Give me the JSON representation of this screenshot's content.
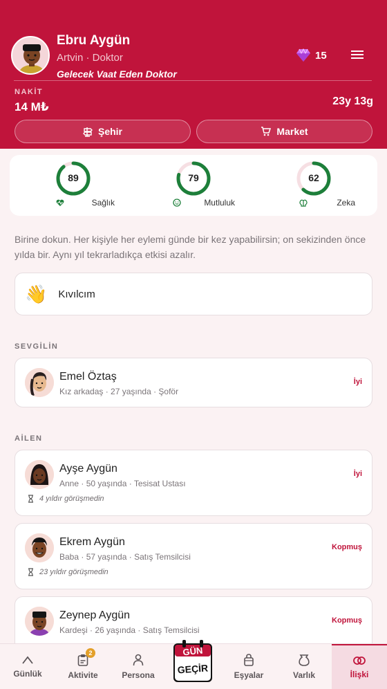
{
  "profile": {
    "name": "Ebru Aygün",
    "location_job": "Artvin · Doktor",
    "title": "Gelecek Vaat Eden Doktor",
    "gems": "15",
    "cash_label": "NAKİT",
    "cash": "14 M₺",
    "age": "23y 13g"
  },
  "buttons": {
    "city": "Şehir",
    "market": "Market"
  },
  "stats": [
    {
      "value": "89",
      "label": "Sağlık",
      "percent": 0.89
    },
    {
      "value": "79",
      "label": "Mutluluk",
      "percent": 0.79
    },
    {
      "value": "62",
      "label": "Zeka",
      "percent": 0.62
    }
  ],
  "description": "Birine dokun. Her kişiyle her eylemi günde bir kez yapabilirsin; on sekizinden önce yılda bir. Aynı yıl tekrarladıkça etkisi azalır.",
  "spark": {
    "emoji": "👋",
    "label": "Kıvılcım"
  },
  "sections": {
    "partner": "SEVGİLİN",
    "family": "AİLEN"
  },
  "partner": {
    "name": "Emel Öztaş",
    "meta": "Kız arkadaş · 27 yaşında · Şoför",
    "status": "İyi"
  },
  "family": [
    {
      "name": "Ayşe Aygün",
      "meta": "Anne · 50 yaşında · Tesisat Ustası",
      "status": "İyi",
      "last": "4 yıldır görüşmedin"
    },
    {
      "name": "Ekrem Aygün",
      "meta": "Baba · 57 yaşında · Satış Temsilcisi",
      "status": "Kopmuş",
      "last": "23 yıldır görüşmedin"
    },
    {
      "name": "Zeynep Aygün",
      "meta": "Kardeşi · 26 yaşında · Satış Temsilcisi",
      "status": "Kopmuş"
    }
  ],
  "nav": {
    "daily": "Günlük",
    "activity": "Aktivite",
    "activity_badge": "2",
    "persona": "Persona",
    "day_top": "GÜN",
    "day_bottom": "GEÇİR",
    "items": "Eşyalar",
    "assets": "Varlık",
    "relations": "İlişki"
  },
  "colors": {
    "brand": "#c0143b",
    "ring": "#1d7f3a",
    "bg": "#fbf2f3"
  }
}
